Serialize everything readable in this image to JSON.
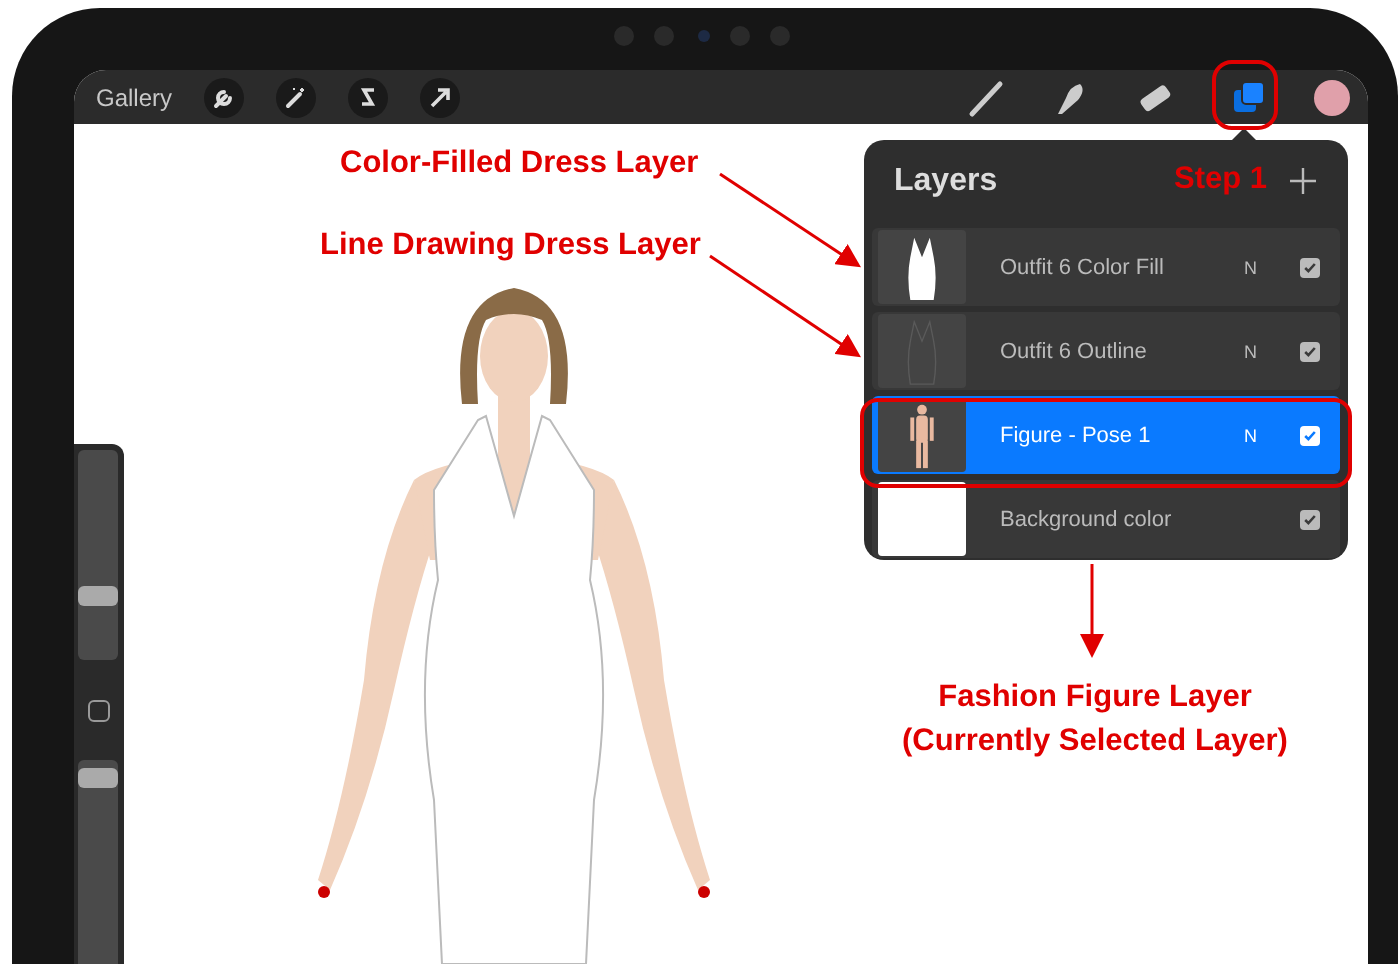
{
  "toolbar": {
    "gallery": "Gallery"
  },
  "sidebar": {
    "brush_size": {
      "level": 0.28
    },
    "opacity": {
      "level": 0.96
    }
  },
  "layers_panel": {
    "title": "Layers",
    "layers": [
      {
        "name": "Outfit 6 Color Fill",
        "blend": "N",
        "visible": true,
        "selected": false,
        "kind": "dress-fill"
      },
      {
        "name": "Outfit 6 Outline",
        "blend": "N",
        "visible": true,
        "selected": false,
        "kind": "dress-outline"
      },
      {
        "name": "Figure - Pose 1",
        "blend": "N",
        "visible": true,
        "selected": true,
        "kind": "figure"
      },
      {
        "name": "Background color",
        "visible": true,
        "selected": false,
        "kind": "background"
      }
    ]
  },
  "annotations": [
    {
      "kind": "color-layer",
      "lines": [
        "Color-Filled Dress Layer"
      ]
    },
    {
      "kind": "line-layer",
      "lines": [
        "Line Drawing Dress Layer"
      ]
    },
    {
      "kind": "step",
      "lines": [
        "Step 1"
      ]
    },
    {
      "kind": "figure-layer",
      "lines": [
        "Fashion Figure Layer",
        "(Currently Selected Layer)"
      ]
    }
  ]
}
